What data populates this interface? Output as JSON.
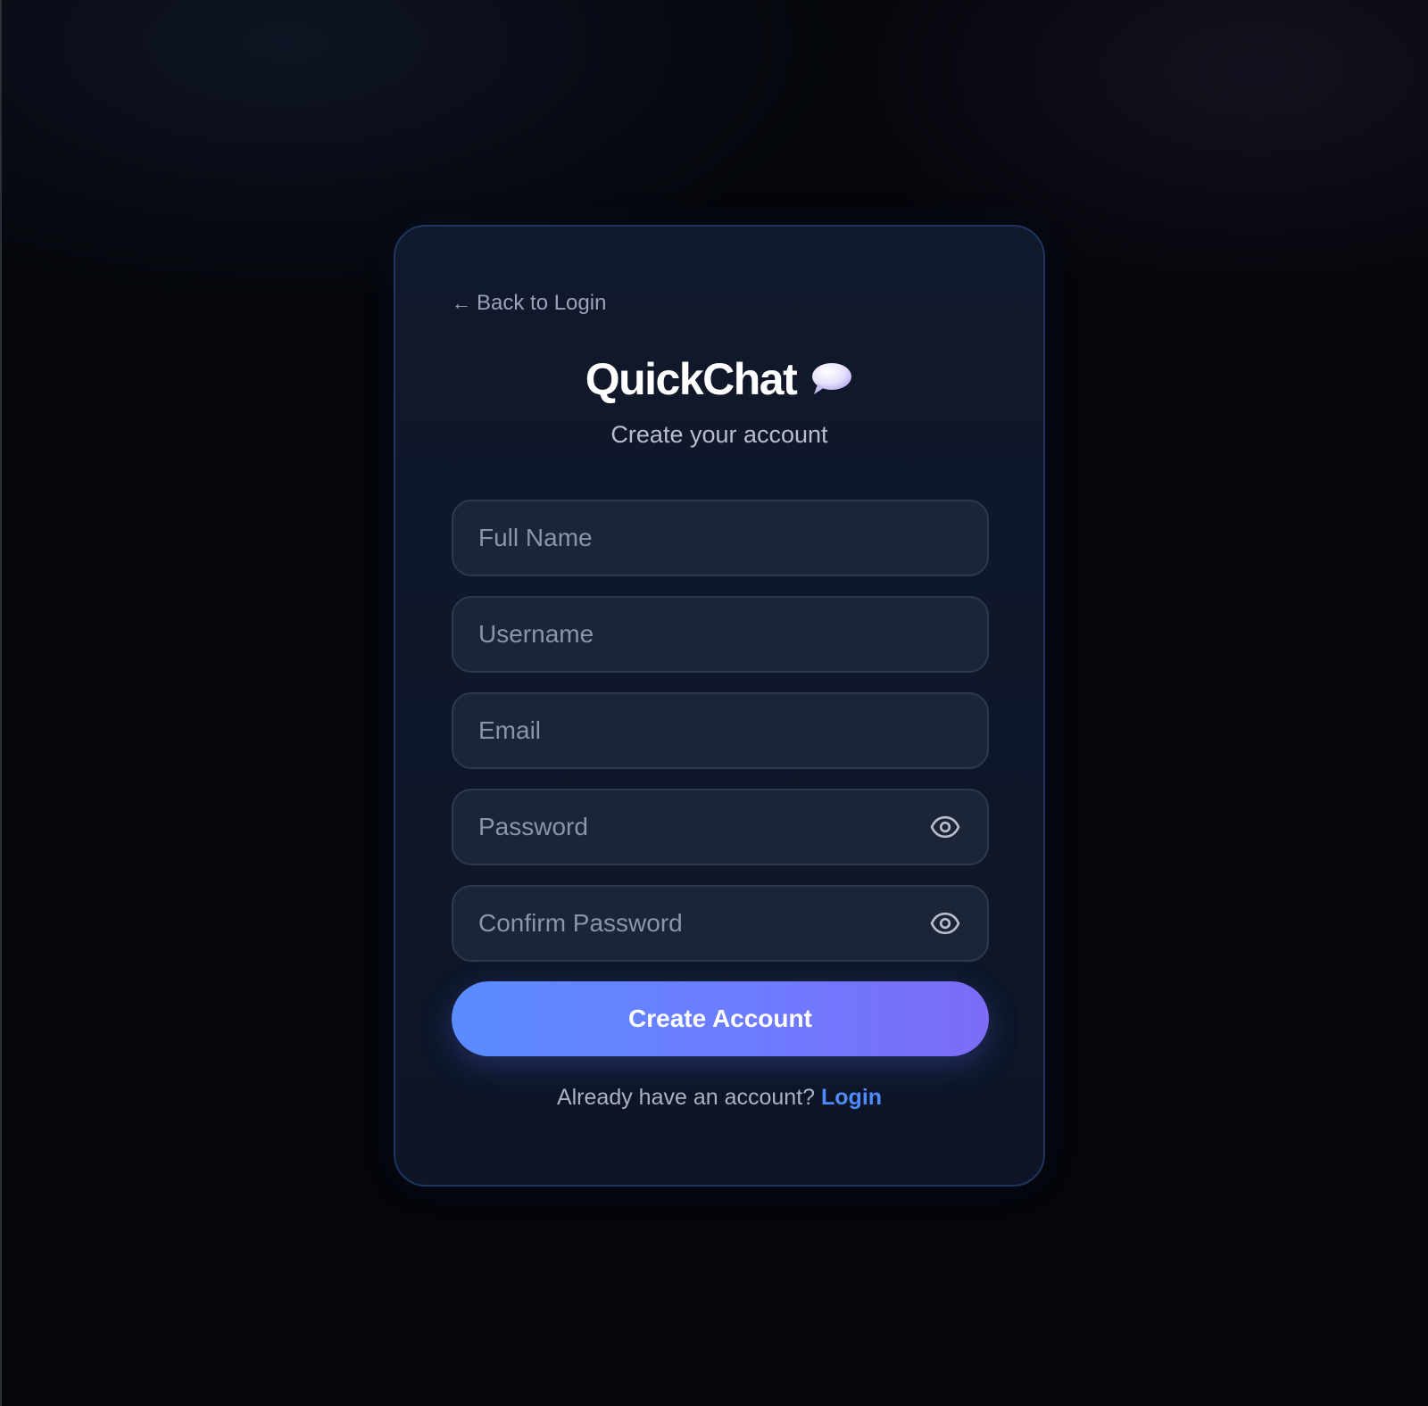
{
  "colors": {
    "background": "#04060b",
    "card_background": "#10182b",
    "card_border": "#1f3560",
    "input_background": "#1c2438",
    "input_border": "#2d394d",
    "placeholder_text": "#8b95a7",
    "button_gradient_start": "#5a8cff",
    "button_gradient_end": "#7c6cf6",
    "link_accent": "#4f8bff"
  },
  "back_link": {
    "arrow": "←",
    "label": "Back to Login",
    "icon": "left-arrow-icon"
  },
  "brand": {
    "title": "QuickChat",
    "icon": "speech-bubble-icon"
  },
  "subtitle": "Create your account",
  "form": {
    "fields": [
      {
        "name": "full-name",
        "placeholder": "Full Name",
        "type": "text",
        "value": ""
      },
      {
        "name": "username",
        "placeholder": "Username",
        "type": "text",
        "value": ""
      },
      {
        "name": "email",
        "placeholder": "Email",
        "type": "email",
        "value": ""
      },
      {
        "name": "password",
        "placeholder": "Password",
        "type": "password",
        "value": "",
        "toggle_icon": "eye-icon"
      },
      {
        "name": "confirm-password",
        "placeholder": "Confirm Password",
        "type": "password",
        "value": "",
        "toggle_icon": "eye-icon"
      }
    ],
    "submit_label": "Create Account"
  },
  "footer": {
    "prompt": "Already have an account?",
    "link_label": "Login"
  }
}
